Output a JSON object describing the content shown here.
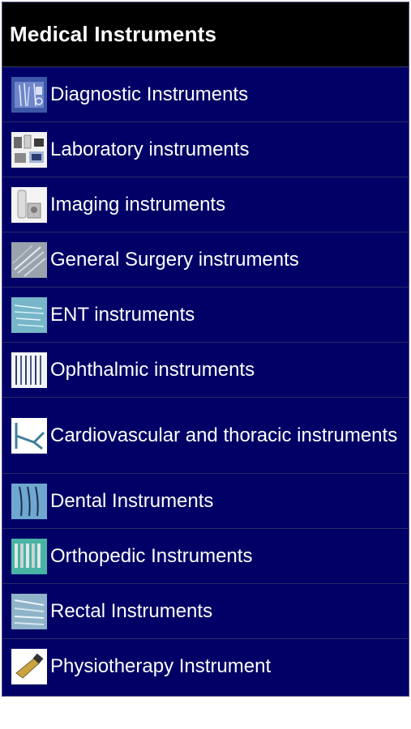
{
  "header": {
    "title": "Medical Instruments"
  },
  "items": [
    {
      "label": "Diagnostic Instruments",
      "icon": "diagnostic-instruments-thumbnail"
    },
    {
      "label": "Laboratory instruments",
      "icon": "laboratory-instruments-thumbnail"
    },
    {
      "label": "Imaging instruments",
      "icon": "imaging-instruments-thumbnail"
    },
    {
      "label": "General Surgery instruments",
      "icon": "general-surgery-instruments-thumbnail"
    },
    {
      "label": "ENT instruments",
      "icon": "ent-instruments-thumbnail"
    },
    {
      "label": "Ophthalmic instruments",
      "icon": "ophthalmic-instruments-thumbnail"
    },
    {
      "label": "Cardiovascular and thoracic instruments",
      "icon": "cardiovascular-instruments-thumbnail"
    },
    {
      "label": "Dental Instruments",
      "icon": "dental-instruments-thumbnail"
    },
    {
      "label": "Orthopedic Instruments",
      "icon": "orthopedic-instruments-thumbnail"
    },
    {
      "label": "Rectal Instruments",
      "icon": "rectal-instruments-thumbnail"
    },
    {
      "label": "Physiotherapy Instrument",
      "icon": "physiotherapy-instrument-thumbnail"
    }
  ],
  "colors": {
    "header_bg": "#000000",
    "list_bg": "#000066",
    "text": "#ffffff"
  }
}
